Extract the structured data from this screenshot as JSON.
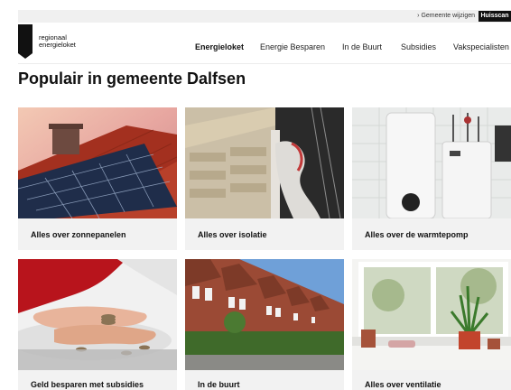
{
  "topbar": {
    "municipality_link": "Gemeente wijzigen",
    "button_label": "Huisscan"
  },
  "logo": {
    "line1": "regionaal",
    "line2": "energieloket"
  },
  "nav": {
    "items": [
      {
        "label": "Energieloket",
        "active": true
      },
      {
        "label": "Energie Besparen",
        "active": false
      },
      {
        "label": "In de Buurt",
        "active": false
      },
      {
        "label": "Subsidies",
        "active": false
      },
      {
        "label": "Vakspecialisten",
        "active": false
      }
    ]
  },
  "main": {
    "title": "Populair in gemeente Dalfsen",
    "cards": [
      {
        "label": "Alles over zonnepanelen"
      },
      {
        "label": "Alles over isolatie"
      },
      {
        "label": "Alles over de warmtepomp"
      },
      {
        "label": "Geld besparen met subsidies"
      },
      {
        "label": "In de buurt"
      },
      {
        "label": "Alles over ventilatie"
      }
    ]
  },
  "colors": {
    "accent": "#111111",
    "card_background": "#f2f2f2",
    "topbar_background": "#f0f0f0"
  }
}
